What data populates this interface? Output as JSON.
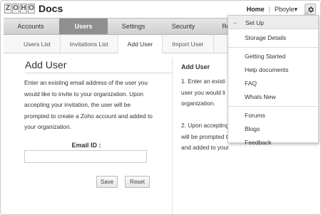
{
  "app": {
    "logo_letters": [
      "Z",
      "O",
      "H",
      "O"
    ],
    "logo_name": "Docs"
  },
  "topbar": {
    "home_label": "Home",
    "separator": "|",
    "user_label": "Pboyle▾",
    "settings_icon": "gear-icon"
  },
  "main_tabs": [
    {
      "label": "Accounts",
      "active": false
    },
    {
      "label": "Users",
      "active": true
    },
    {
      "label": "Settings",
      "active": false
    },
    {
      "label": "Security",
      "active": false
    },
    {
      "label": "Reports",
      "active": false
    }
  ],
  "sub_tabs": [
    {
      "label": "Users List",
      "active": false
    },
    {
      "label": "Invitations List",
      "active": false
    },
    {
      "label": "Add User",
      "active": true
    },
    {
      "label": "Import User",
      "active": false
    }
  ],
  "form": {
    "title": "Add User",
    "description": "Enter an existing email address of the user you would like to invite to your organization. Upon accepting your invitation, the user will be prompted to create a Zoho account and added to your organization.",
    "email_label": "Email ID :",
    "email_value": "",
    "save_label": "Save",
    "reset_label": "Reset"
  },
  "help": {
    "title": "Add User",
    "body": "1.  Enter an existi\nuser you would li\norganization.\n\n2.  Upon accepting\nwill be prompted t\nand added to your"
  },
  "dropdown": {
    "header_arrow": "←",
    "header_label": "Set Up",
    "groups": [
      [
        "Storage Details"
      ],
      [
        "Getting Started",
        "Help documents",
        "FAQ",
        "Whats New"
      ],
      [
        "Forums",
        "Blogs",
        "Feedback"
      ]
    ]
  }
}
